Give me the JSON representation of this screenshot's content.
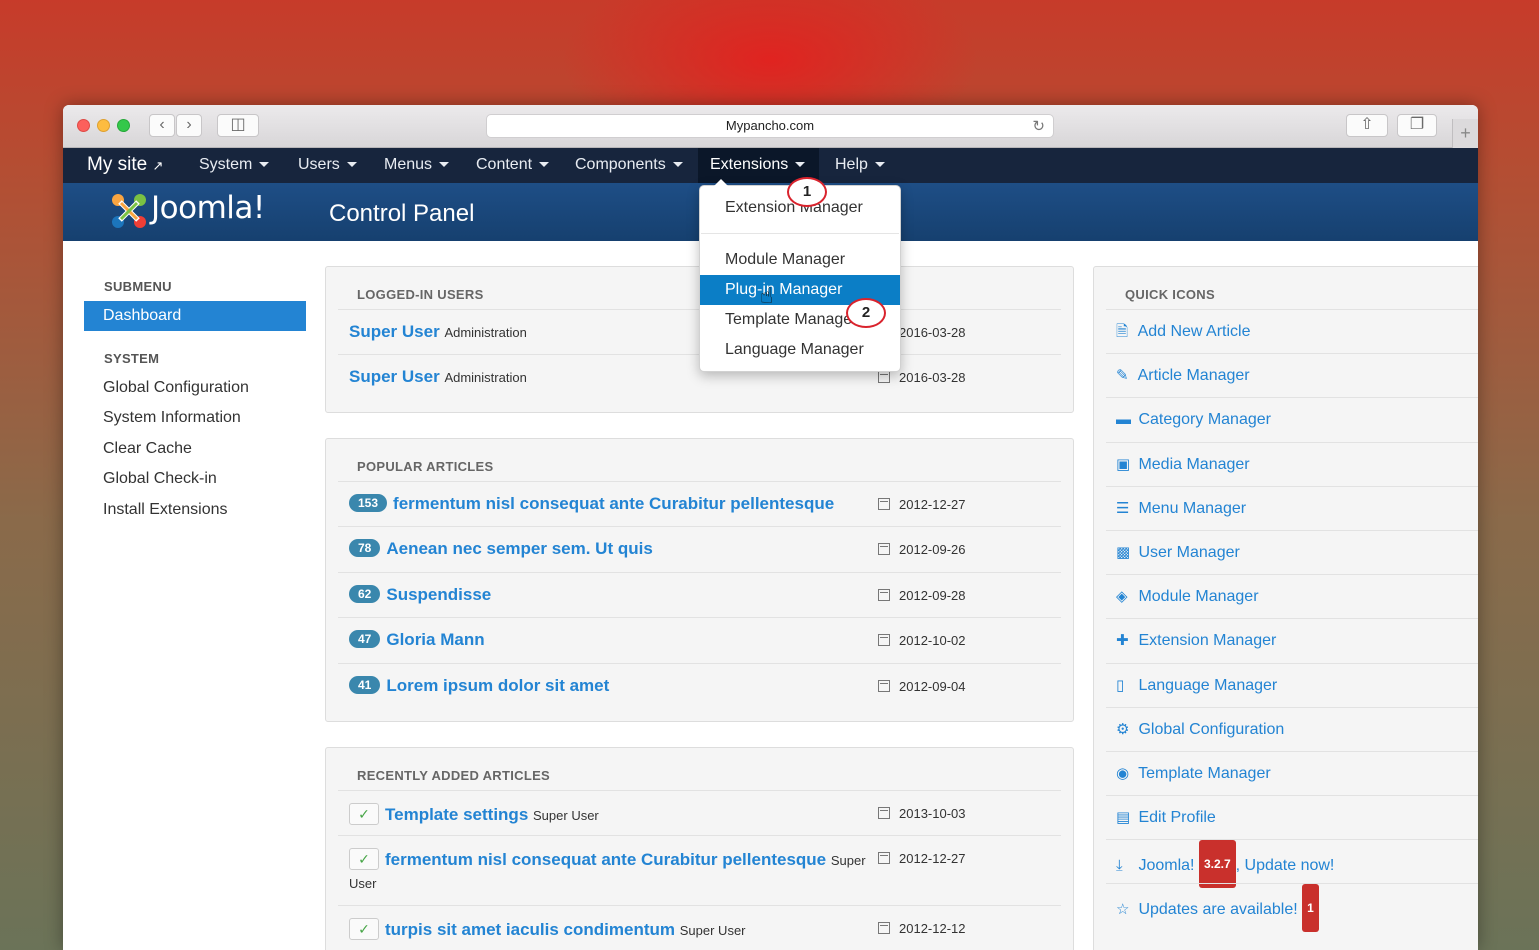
{
  "browser": {
    "url": "Mypancho.com"
  },
  "topnav": {
    "brand": "My site",
    "items": [
      "System",
      "Users",
      "Menus",
      "Content",
      "Components",
      "Extensions",
      "Help"
    ]
  },
  "header": {
    "logo_text": "Joomla!",
    "page_title": "Control Panel"
  },
  "sidebar": {
    "submenu_heading": "SUBMENU",
    "active_item": "Dashboard",
    "system_heading": "SYSTEM",
    "items": [
      "Global Configuration",
      "System Information",
      "Clear Cache",
      "Global Check-in",
      "Install Extensions"
    ]
  },
  "dropdown": {
    "items": [
      "Extension Manager",
      "Module Manager",
      "Plug-in Manager",
      "Template Manager",
      "Language Manager"
    ],
    "callouts": [
      "1",
      "2"
    ]
  },
  "logged_in": {
    "title": "LOGGED-IN USERS",
    "rows": [
      {
        "name": "Super User",
        "sub": "Administration",
        "date": "2016-03-28"
      },
      {
        "name": "Super User",
        "sub": "Administration",
        "date": "2016-03-28"
      }
    ]
  },
  "popular": {
    "title": "POPULAR ARTICLES",
    "rows": [
      {
        "hits": "153",
        "title": "fermentum nisl consequat ante Curabitur pellentesque",
        "date": "2012-12-27"
      },
      {
        "hits": "78",
        "title": "Aenean nec semper sem. Ut quis",
        "date": "2012-09-26"
      },
      {
        "hits": "62",
        "title": "Suspendisse",
        "date": "2012-09-28"
      },
      {
        "hits": "47",
        "title": "Gloria Mann",
        "date": "2012-10-02"
      },
      {
        "hits": "41",
        "title": "Lorem ipsum dolor sit amet",
        "date": "2012-09-04"
      }
    ]
  },
  "recent": {
    "title": "RECENTLY ADDED ARTICLES",
    "rows": [
      {
        "title": "Template settings",
        "author": "Super User",
        "date": "2013-10-03"
      },
      {
        "title": "fermentum nisl consequat ante Curabitur pellentesque",
        "author": "Super",
        "author2": "User",
        "date": "2012-12-27"
      },
      {
        "title": "turpis sit amet iaculis condimentum",
        "author": "Super User",
        "date": "2012-12-12"
      }
    ]
  },
  "quick_icons": {
    "title": "QUICK ICONS",
    "items": [
      {
        "label": "Add New Article",
        "icon": "new-article-icon"
      },
      {
        "label": "Article Manager",
        "icon": "pencil-icon"
      },
      {
        "label": "Category Manager",
        "icon": "folder-icon"
      },
      {
        "label": "Media Manager",
        "icon": "image-icon"
      },
      {
        "label": "Menu Manager",
        "icon": "list-icon"
      },
      {
        "label": "User Manager",
        "icon": "user-book-icon"
      },
      {
        "label": "Module Manager",
        "icon": "cube-icon"
      },
      {
        "label": "Extension Manager",
        "icon": "puzzle-icon"
      },
      {
        "label": "Language Manager",
        "icon": "comments-icon"
      },
      {
        "label": "Global Configuration",
        "icon": "cog-icon"
      },
      {
        "label": "Template Manager",
        "icon": "eye-icon"
      },
      {
        "label": "Edit Profile",
        "icon": "vcard-icon"
      }
    ],
    "joomla_update": {
      "prefix": "Joomla!",
      "version": "3.2.7",
      "suffix": ", Update now!"
    },
    "updates": {
      "label": "Updates are available!",
      "count": "1"
    }
  }
}
